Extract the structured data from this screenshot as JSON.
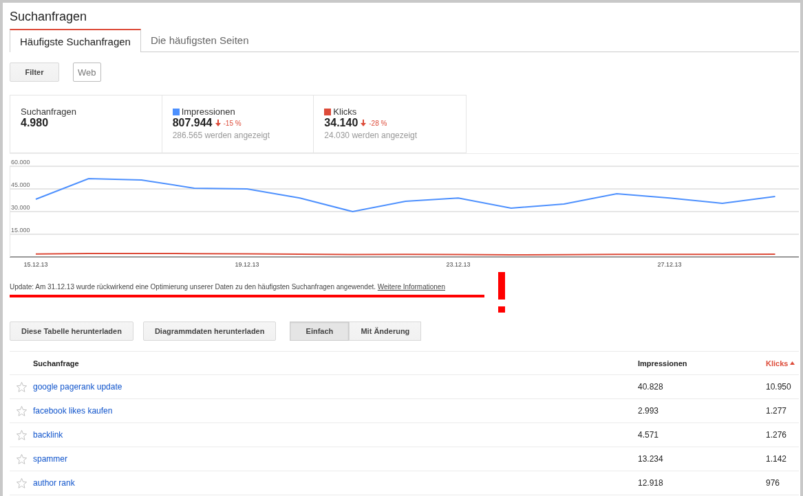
{
  "title": "Suchanfragen",
  "tabs": [
    {
      "label": "Häufigste Suchanfragen",
      "selected": true
    },
    {
      "label": "Die häufigsten Seiten",
      "selected": false
    }
  ],
  "filter_buttons": [
    {
      "label": "Filter",
      "kind": "button"
    },
    {
      "label": "Web",
      "kind": "chip"
    }
  ],
  "metrics": [
    {
      "label": "Suchanfragen",
      "value": "4.980"
    },
    {
      "label": "Impressionen",
      "value": "807.944",
      "change": "-15 %",
      "shown": "286.565 werden angezeigt",
      "color": "#4d90fe"
    },
    {
      "label": "Klicks",
      "value": "34.140",
      "change": "-28 %",
      "shown": "24.030 werden angezeigt",
      "color": "#dd4b39"
    }
  ],
  "chart": {
    "chart_data": {
      "type": "line",
      "categories": [
        "15.12.13",
        null,
        null,
        null,
        "19.12.13",
        null,
        null,
        null,
        "23.12.13",
        null,
        null,
        null,
        "27.12.13",
        null,
        null
      ],
      "series": [
        {
          "color": "#4d90fe",
          "values": [
            38200,
            51800,
            50900,
            45500,
            45000,
            39000,
            30000,
            36800,
            39000,
            32300,
            35000,
            41800,
            39000,
            35500,
            40000
          ]
        },
        {
          "color": "#dd4b39",
          "values": [
            1900,
            2300,
            2300,
            2200,
            2000,
            1800,
            1600,
            1700,
            1600,
            1300,
            1500,
            1700,
            1700,
            1700,
            1800
          ]
        }
      ],
      "ylim": [
        0,
        60000
      ],
      "grid": true,
      "yticks": [
        {
          "value": 15000,
          "label": "15.000"
        },
        {
          "value": 30000,
          "label": "30.000"
        },
        {
          "value": 45000,
          "label": "45.000"
        },
        {
          "value": 60000,
          "label": "60.000"
        }
      ]
    }
  },
  "notice": {
    "text": "Update: Am 31.12.13 wurde rückwirkend eine Optimierung unserer Daten zu den häufigsten Suchanfragen angewendet.",
    "link": "Weitere Informationen"
  },
  "actions": [
    {
      "label": "Diese Tabelle herunterladen"
    },
    {
      "label": "Diagrammdaten herunterladen"
    }
  ],
  "view_toggle": [
    {
      "label": "Einfach",
      "selected": true
    },
    {
      "label": "Mit Änderung",
      "selected": false
    }
  ],
  "table": {
    "columns": [
      {
        "label": "Suchanfrage",
        "sorted": false
      },
      {
        "label": "Impressionen",
        "sorted": false
      },
      {
        "label": "Klicks",
        "sorted": true
      }
    ],
    "rows": [
      {
        "starred": false,
        "query": "google pagerank update",
        "impressions": "40.828",
        "clicks": "10.950"
      },
      {
        "starred": false,
        "query": "facebook likes kaufen",
        "impressions": "2.993",
        "clicks": "1.277"
      },
      {
        "starred": false,
        "query": "backlink",
        "impressions": "4.571",
        "clicks": "1.276"
      },
      {
        "starred": false,
        "query": "spammer",
        "impressions": "13.234",
        "clicks": "1.142"
      },
      {
        "starred": false,
        "query": "author rank",
        "impressions": "12.918",
        "clicks": "976"
      }
    ]
  }
}
